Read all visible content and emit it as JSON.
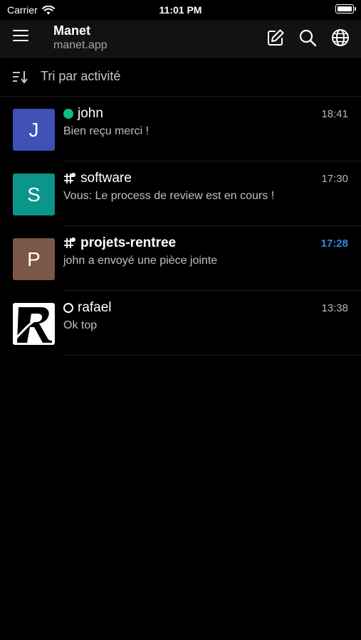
{
  "status_bar": {
    "carrier": "Carrier",
    "time": "11:01 PM"
  },
  "header": {
    "title": "Manet",
    "subtitle": "manet.app",
    "icons": [
      "menu-icon",
      "compose-icon",
      "search-icon",
      "globe-icon"
    ]
  },
  "sort": {
    "label": "Tri par activité"
  },
  "rooms": [
    {
      "name": "john",
      "preview": "Bien reçu merci !",
      "time": "18:41",
      "avatar_letter": "J",
      "avatar_color": "#3f51b5",
      "presence": "online",
      "bold": false,
      "unread": false
    },
    {
      "name": "software",
      "preview": "Vous: Le process de review est en cours !",
      "time": "17:30",
      "avatar_letter": "S",
      "avatar_color": "#0a968a",
      "presence": "group",
      "bold": false,
      "unread": false
    },
    {
      "name": "projets-rentree",
      "preview": "john a envoyé une pièce jointe",
      "time": "17:28",
      "avatar_letter": "P",
      "avatar_color": "#7b5747",
      "presence": "group",
      "bold": true,
      "unread": true
    },
    {
      "name": "rafael",
      "preview": "Ok top",
      "time": "13:38",
      "avatar_letter": "",
      "avatar_color": "#ffffff",
      "presence": "offline",
      "bold": false,
      "unread": false
    }
  ],
  "colors": {
    "background": "#000000",
    "header": "#121212",
    "accent": "#2d8cdf",
    "online": "#0dbd8b"
  }
}
